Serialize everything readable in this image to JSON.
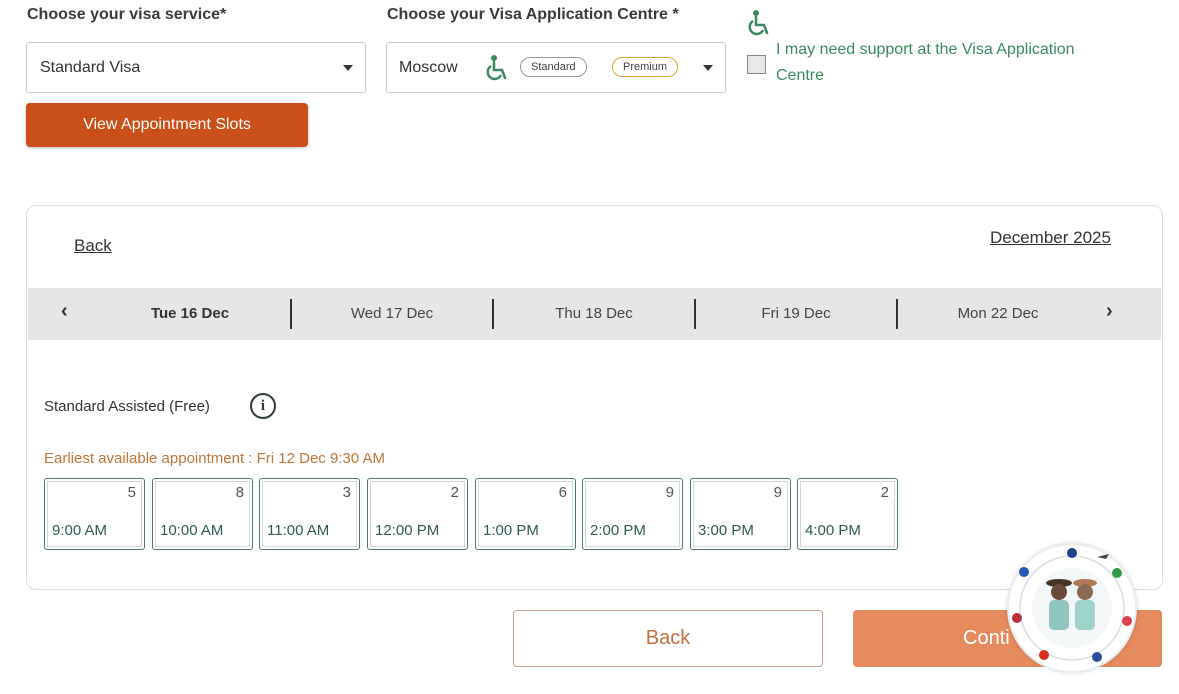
{
  "form": {
    "visa_service_label": "Choose your visa service*",
    "visa_service_value": "Standard Visa",
    "centre_label": "Choose your Visa Application Centre *",
    "centre_value": "Moscow",
    "pill_standard": "Standard",
    "pill_premium": "Premium",
    "support_text": "I may need support at the Visa Application Centre",
    "view_slots_button": "View Appointment Slots"
  },
  "panel": {
    "back_link": "Back",
    "month_link": "December 2025",
    "dates": [
      {
        "label": "Tue 16 Dec",
        "active": true
      },
      {
        "label": "Wed 17 Dec",
        "active": false
      },
      {
        "label": "Thu 18 Dec",
        "active": false
      },
      {
        "label": "Fri 19 Dec",
        "active": false
      },
      {
        "label": "Mon 22 Dec",
        "active": false
      }
    ],
    "assist_label": "Standard Assisted (Free)",
    "earliest_text": "Earliest available appointment : Fri 12 Dec 9:30 AM",
    "slots": [
      {
        "time": "9:00 AM",
        "count": "5"
      },
      {
        "time": "10:00 AM",
        "count": "8"
      },
      {
        "time": "11:00 AM",
        "count": "3"
      },
      {
        "time": "12:00 PM",
        "count": "2"
      },
      {
        "time": "1:00 PM",
        "count": "6"
      },
      {
        "time": "2:00 PM",
        "count": "9"
      },
      {
        "time": "3:00 PM",
        "count": "9"
      },
      {
        "time": "4:00 PM",
        "count": "2"
      }
    ]
  },
  "footer": {
    "back_button": "Back",
    "continue_button": "Conti"
  },
  "colors": {
    "accent": "#cb4f18",
    "continue": "#e48a5c",
    "support_green": "#3a8a60",
    "slot_border": "#4a7a6c"
  },
  "icons": {
    "wheelchair": "wheelchair-icon",
    "prev": "chevron-left-icon",
    "next": "chevron-right-icon",
    "info": "info-icon",
    "caret": "caret-down-icon"
  }
}
